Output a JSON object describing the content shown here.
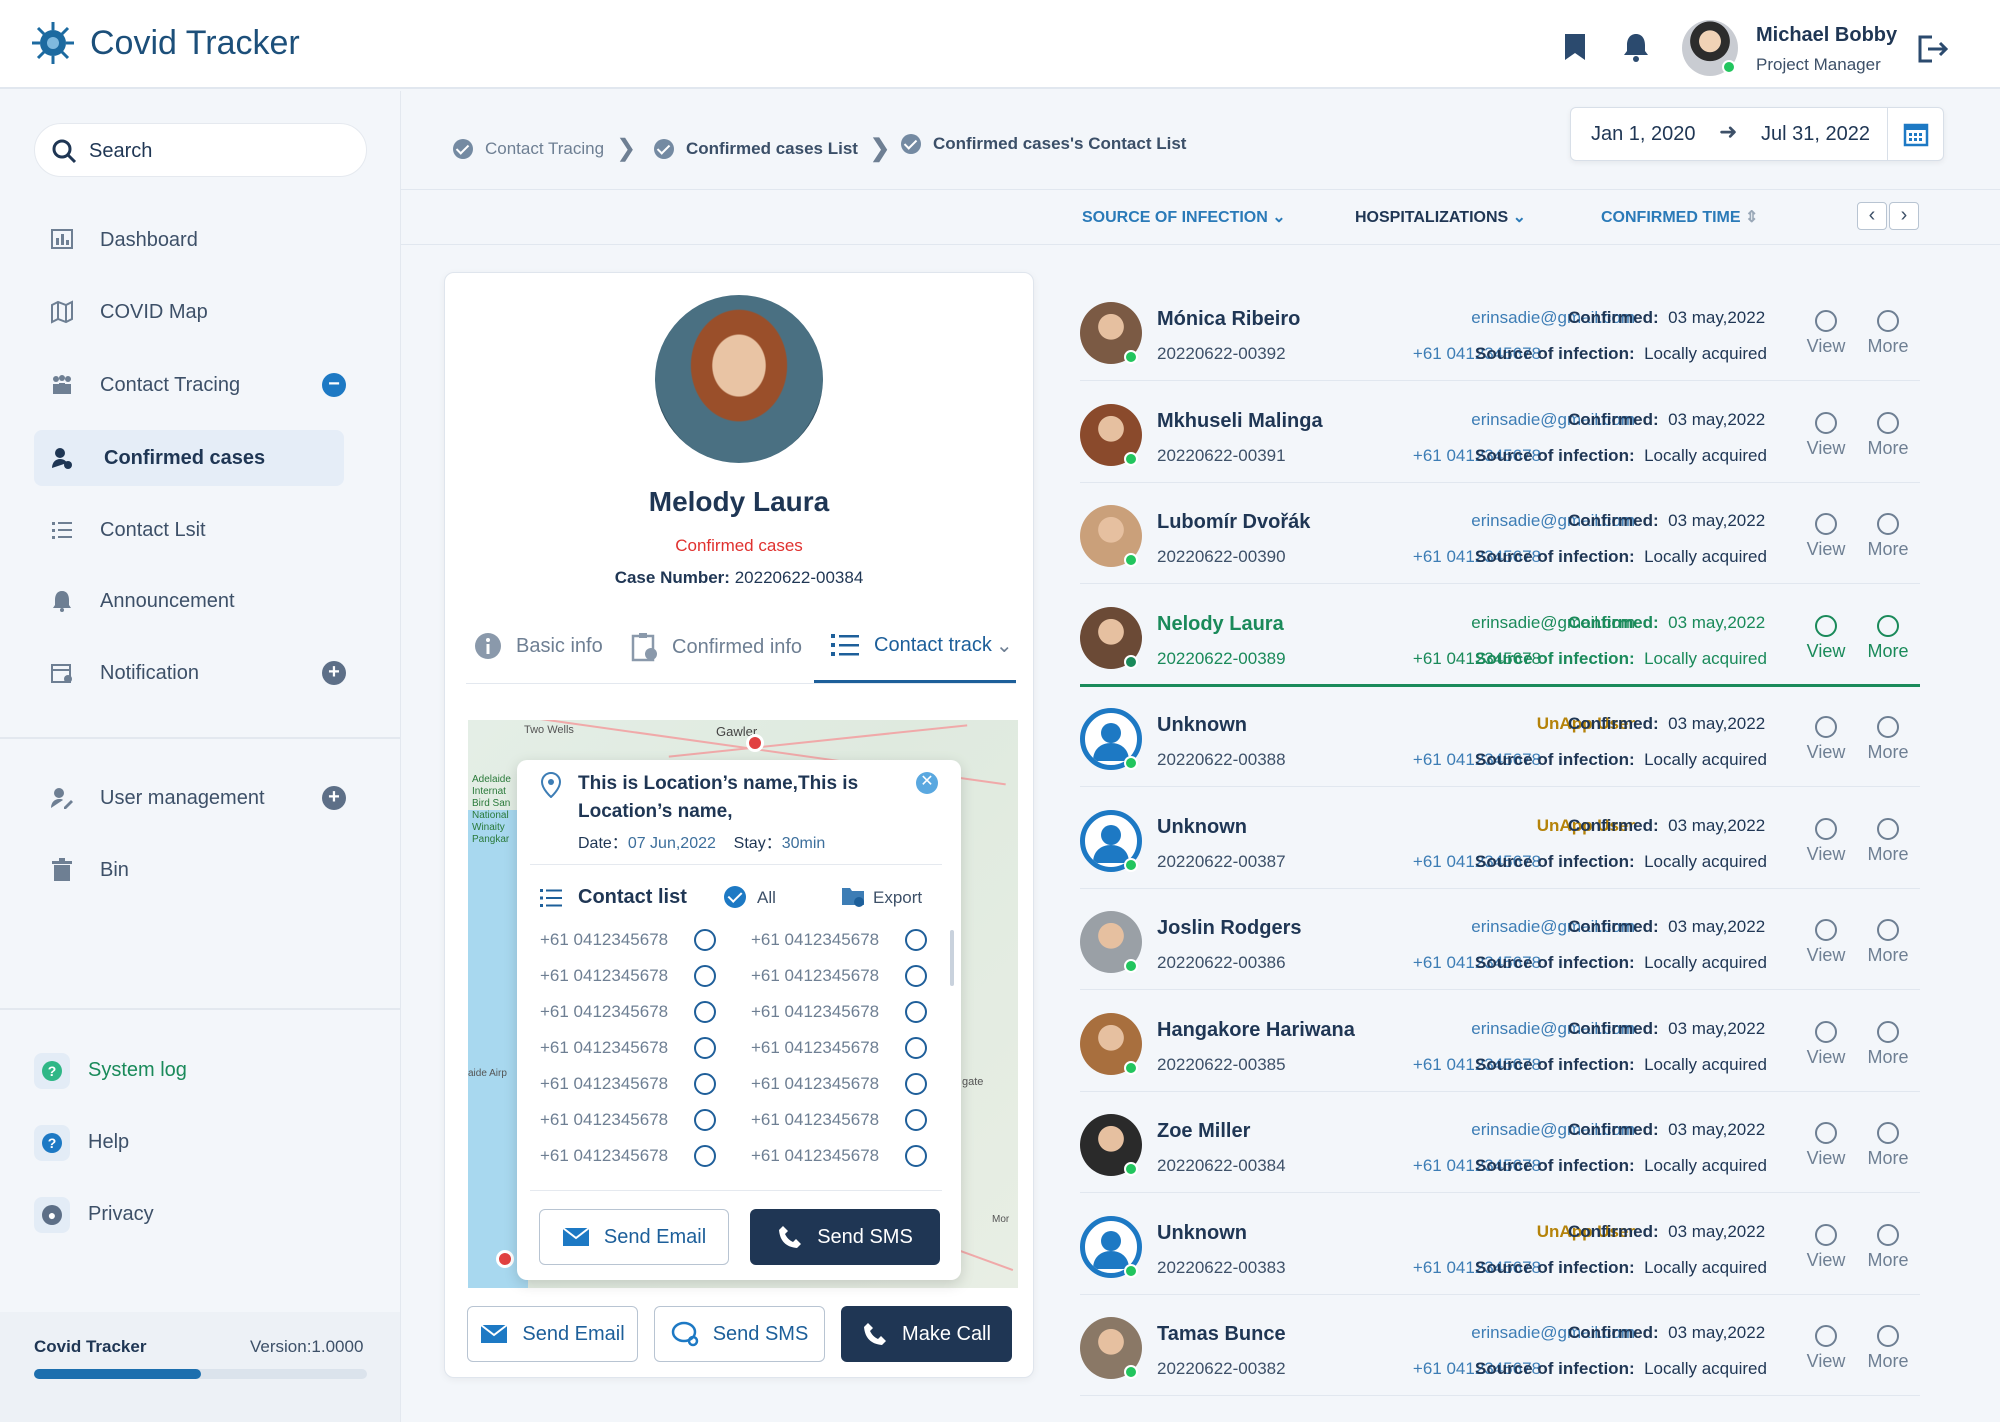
{
  "app": {
    "title": "Covid Tracker"
  },
  "user": {
    "name": "Michael Bobby",
    "role": "Project Manager"
  },
  "sidebar": {
    "search_placeholder": "Search",
    "items": [
      {
        "label": "Dashboard"
      },
      {
        "label": "COVID Map"
      },
      {
        "label": "Contact Tracing",
        "expander": "−"
      },
      {
        "label": "Confirmed cases"
      },
      {
        "label": "Contact Lsit"
      },
      {
        "label": "Announcement"
      },
      {
        "label": "Notification",
        "expander": "+"
      },
      {
        "label": "User management",
        "expander": "+"
      },
      {
        "label": "Bin"
      }
    ],
    "bottom": [
      {
        "label": "System log"
      },
      {
        "label": "Help"
      },
      {
        "label": "Privacy"
      }
    ],
    "footer": {
      "title": "Covid Tracker",
      "version": "Version:1.0000",
      "progress_fraction": 0.5
    }
  },
  "breadcrumb": [
    "Contact Tracing",
    "Confirmed cases List",
    "Confirmed cases's Contact List"
  ],
  "daterange": {
    "start": "Jan 1, 2020",
    "end": "Jul 31, 2022"
  },
  "sortbar": {
    "source": "SOURCE OF INFECTION",
    "hosp": "HOSPITALIZATIONS",
    "time": "CONFIRMED TIME",
    "colors": {
      "active": "#2a7ab8",
      "default": "#1f3654"
    }
  },
  "profile": {
    "name": "Melody Laura",
    "status": "Confirmed cases",
    "case_label": "Case Number:",
    "case_number": "20220622-00384"
  },
  "tabs": [
    "Basic info",
    "Confirmed info",
    "Contact track"
  ],
  "map": {
    "labels": [
      "Two Wells",
      "Gawler",
      "Adelaide",
      "Internat",
      "Bird San",
      "National",
      "Winaity",
      "Pangkar",
      "aide Airp",
      "gate",
      "Mor"
    ]
  },
  "popup": {
    "location": "This is Location’s name,This is Location’s name,",
    "date_label": "Date：",
    "date": "07 Jun,2022",
    "stay_label": "Stay：",
    "stay": "30min",
    "contact_list": "Contact list",
    "all": "All",
    "export": "Export",
    "phones": [
      "+61 0412345678",
      "+61 0412345678",
      "+61 0412345678",
      "+61 0412345678",
      "+61 0412345678",
      "+61 0412345678",
      "+61 0412345678"
    ],
    "send_email": "Send Email",
    "send_sms": "Send SMS"
  },
  "card_buttons": {
    "email": "Send Email",
    "sms": "Send SMS",
    "call": "Make Call"
  },
  "cases": [
    {
      "name": "Mónica Ribeiro",
      "id": "20220622-00392",
      "email": "erinsadie@gmail.com",
      "phone": "+61 0412345678",
      "confirmed_label": "Confirmed:",
      "confirmed": "03 may,2022",
      "source_label": "Source of infection:",
      "source": "Locally acquired",
      "view": "View",
      "more": "More"
    },
    {
      "name": "Mkhuseli Malinga",
      "id": "20220622-00391",
      "email": "erinsadie@gmail.com",
      "phone": "+61 0412345678",
      "confirmed_label": "Confirmed:",
      "confirmed": "03 may,2022",
      "source_label": "Source of infection:",
      "source": "Locally acquired",
      "view": "View",
      "more": "More"
    },
    {
      "name": "Lubomír Dvořák",
      "id": "20220622-00390",
      "email": "erinsadie@gmail.com",
      "phone": "+61 0412345678",
      "confirmed_label": "Confirmed:",
      "confirmed": "03 may,2022",
      "source_label": "Source of infection:",
      "source": "Locally acquired",
      "view": "View",
      "more": "More"
    },
    {
      "name": "Nelody Laura",
      "id": "20220622-00389",
      "email": "erinsadie@gmail.com",
      "phone": "+61 0412345678",
      "confirmed_label": "Confirmed:",
      "confirmed": "03 may,2022",
      "source_label": "Source of infection:",
      "source": "Locally acquired",
      "view": "View",
      "more": "More",
      "selected": true
    },
    {
      "name": "Unknown",
      "id": "20220622-00388",
      "email": "UnApp User",
      "phone": "+61 0412345678",
      "confirmed_label": "Confirmed:",
      "confirmed": "03 may,2022",
      "source_label": "Source of infection:",
      "source": "Locally acquired",
      "view": "View",
      "more": "More",
      "unknown": true
    },
    {
      "name": "Unknown",
      "id": "20220622-00387",
      "email": "UnApp User",
      "phone": "+61 0412345678",
      "confirmed_label": "Confirmed:",
      "confirmed": "03 may,2022",
      "source_label": "Source of infection:",
      "source": "Locally acquired",
      "view": "View",
      "more": "More",
      "unknown": true
    },
    {
      "name": "Joslin Rodgers",
      "id": "20220622-00386",
      "email": "erinsadie@gmail.com",
      "phone": "+61 0412345678",
      "confirmed_label": "Confirmed:",
      "confirmed": "03 may,2022",
      "source_label": "Source of infection:",
      "source": "Locally acquired",
      "view": "View",
      "more": "More"
    },
    {
      "name": "Hangakore Hariwana",
      "id": "20220622-00385",
      "email": "erinsadie@gmail.com",
      "phone": "+61 0412345678",
      "confirmed_label": "Confirmed:",
      "confirmed": "03 may,2022",
      "source_label": "Source of infection:",
      "source": "Locally acquired",
      "view": "View",
      "more": "More"
    },
    {
      "name": "Zoe Miller",
      "id": "20220622-00384",
      "email": "erinsadie@gmail.com",
      "phone": "+61 0412345678",
      "confirmed_label": "Confirmed:",
      "confirmed": "03 may,2022",
      "source_label": "Source of infection:",
      "source": "Locally acquired",
      "view": "View",
      "more": "More"
    },
    {
      "name": "Unknown",
      "id": "20220622-00383",
      "email": "UnApp User",
      "phone": "+61 0412345678",
      "confirmed_label": "Confirmed:",
      "confirmed": "03 may,2022",
      "source_label": "Source of infection:",
      "source": "Locally acquired",
      "view": "View",
      "more": "More",
      "unknown": true
    },
    {
      "name": "Tamas Bunce",
      "id": "20220622-00382",
      "email": "erinsadie@gmail.com",
      "phone": "+61 0412345678",
      "confirmed_label": "Confirmed:",
      "confirmed": "03 may,2022",
      "source_label": "Source of infection:",
      "source": "Locally acquired",
      "view": "View",
      "more": "More"
    }
  ]
}
